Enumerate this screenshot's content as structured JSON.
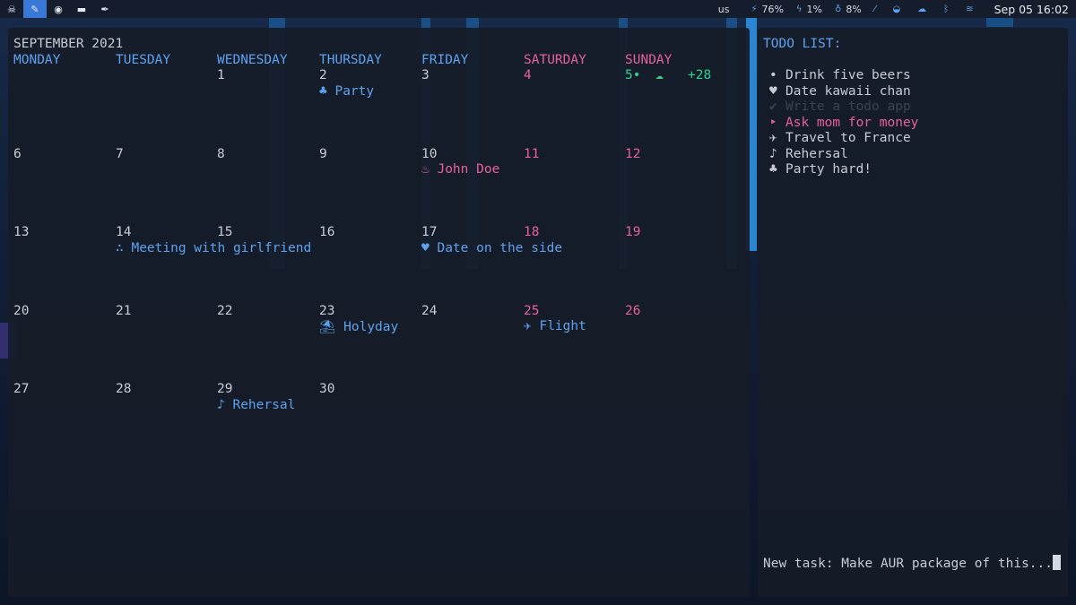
{
  "topbar": {
    "workspaces": [
      {
        "icon": "☠",
        "name": "skull-icon"
      },
      {
        "icon": "✎",
        "name": "pencil-icon"
      },
      {
        "icon": "◉",
        "name": "compass-icon"
      },
      {
        "icon": "▬",
        "name": "terminal-icon"
      },
      {
        "icon": "✒",
        "name": "feather-icon"
      }
    ],
    "keyboard": "us",
    "cpu": "76%",
    "battery": "1%",
    "memory": "8%",
    "clock": "Sep 05 16:02"
  },
  "calendar": {
    "title": "SEPTEMBER 2021",
    "weekdays": [
      "MONDAY",
      "TUESDAY",
      "WEDNESDAY",
      "THURSDAY",
      "FRIDAY",
      "SATURDAY",
      "SUNDAY"
    ],
    "days": {
      "d1": "1",
      "d2": "2",
      "d3": "3",
      "d4": "4",
      "d5": "5•",
      "d6": "6",
      "d7": "7",
      "d8": "8",
      "d9": "9",
      "d10": "10",
      "d11": "11",
      "d12": "12",
      "d13": "13",
      "d14": "14",
      "d15": "15",
      "d16": "16",
      "d17": "17",
      "d18": "18",
      "d19": "19",
      "d20": "20",
      "d21": "21",
      "d22": "22",
      "d23": "23",
      "d24": "24",
      "d25": "25",
      "d26": "26",
      "d27": "27",
      "d28": "28",
      "d29": "29",
      "d30": "30"
    },
    "weather": {
      "icon": "☁",
      "temp": "+28"
    },
    "events": {
      "party": "♣ Party",
      "john": "♨ John Doe",
      "meeting": "∴ Meeting with girlfriend",
      "date": "♥ Date on the side",
      "holyday": "⛱ Holyday",
      "flight": "✈ Flight",
      "rehersal": "♪ Rehersal"
    }
  },
  "todo": {
    "title": "TODO LIST:",
    "items": [
      {
        "bullet": "•",
        "text": "Drink five beers"
      },
      {
        "bullet": "♥",
        "text": "Date kawaii chan"
      },
      {
        "bullet": "✔",
        "text": "Write a todo app"
      },
      {
        "bullet": "‣",
        "text": "Ask mom for money"
      },
      {
        "bullet": "✈",
        "text": "Travel to France"
      },
      {
        "bullet": "♪",
        "text": "Rehersal"
      },
      {
        "bullet": "♣",
        "text": "Party hard!"
      }
    ],
    "new_task": "New task: Make AUR package of this..."
  },
  "colors": {
    "accent": "#5ea2ef",
    "weekend": "#e8609a",
    "today": "#2fd18f"
  }
}
